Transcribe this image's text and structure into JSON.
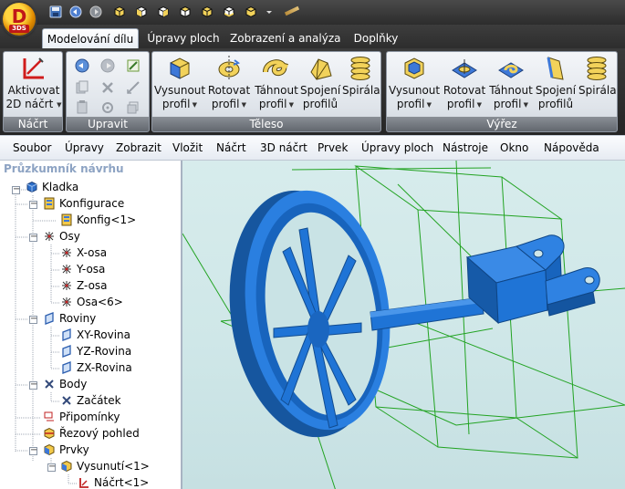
{
  "app": {
    "logo_letter": "D",
    "logo_badge": "3DS"
  },
  "ribbon": {
    "tabs": [
      {
        "label": "Modelování dílu",
        "active": true
      },
      {
        "label": "Úpravy ploch",
        "active": false
      },
      {
        "label": "Zobrazení a analýza",
        "active": false
      },
      {
        "label": "Doplňky",
        "active": false
      }
    ],
    "groups": {
      "sketch": {
        "label": "Náčrt",
        "activate_line1": "Aktivovat",
        "activate_line2": "2D náčrt"
      },
      "edit": {
        "label": "Upravit"
      },
      "solid": {
        "label": "Těleso",
        "buttons": [
          {
            "line1": "Vysunout",
            "line2": "profil"
          },
          {
            "line1": "Rotovat",
            "line2": "profil"
          },
          {
            "line1": "Táhnout",
            "line2": "profil"
          },
          {
            "line1": "Spojení",
            "line2": "profilů"
          },
          {
            "line1": "Spirála",
            "line2": ""
          }
        ]
      },
      "cut": {
        "label": "Výřez",
        "buttons": [
          {
            "line1": "Vysunout",
            "line2": "profil"
          },
          {
            "line1": "Rotovat",
            "line2": "profil"
          },
          {
            "line1": "Táhnout",
            "line2": "profil"
          },
          {
            "line1": "Spojení",
            "line2": "profilů"
          },
          {
            "line1": "Spirála",
            "line2": ""
          }
        ]
      }
    }
  },
  "menu": [
    "Soubor",
    "Úpravy",
    "Zobrazit",
    "Vložit",
    "Náčrt",
    "3D náčrt",
    "Prvek",
    "Úpravy ploch",
    "Nástroje",
    "Okno",
    "Nápověda"
  ],
  "explorer": {
    "title": "Průzkumník návrhu",
    "nodes": [
      {
        "label": "Kladka",
        "icon": "part-icon"
      },
      {
        "label": "Konfigurace",
        "icon": "config-icon"
      },
      {
        "label": "Konfig<1>",
        "icon": "config-item-icon"
      },
      {
        "label": "Osy",
        "icon": "axis-icon"
      },
      {
        "label": "X-osa",
        "icon": "axis-icon"
      },
      {
        "label": "Y-osa",
        "icon": "axis-icon"
      },
      {
        "label": "Z-osa",
        "icon": "axis-icon"
      },
      {
        "label": "Osa<6>",
        "icon": "axis-icon"
      },
      {
        "label": "Roviny",
        "icon": "plane-icon"
      },
      {
        "label": "XY-Rovina",
        "icon": "plane-icon"
      },
      {
        "label": "YZ-Rovina",
        "icon": "plane-icon"
      },
      {
        "label": "ZX-Rovina",
        "icon": "plane-icon"
      },
      {
        "label": "Body",
        "icon": "point-icon"
      },
      {
        "label": "Začátek",
        "icon": "point-icon"
      },
      {
        "label": "Připomínky",
        "icon": "annotation-icon"
      },
      {
        "label": "Řezový pohled",
        "icon": "section-view-icon"
      },
      {
        "label": "Prvky",
        "icon": "features-icon"
      },
      {
        "label": "Vysunutí<1>",
        "icon": "extrude-feature-icon"
      },
      {
        "label": "Náčrt<1>",
        "icon": "sketch-icon"
      }
    ]
  },
  "colors": {
    "model_blue": "#1f74d6",
    "wire_green": "#1fa31f",
    "viewport_bg": "#d3eaea"
  }
}
